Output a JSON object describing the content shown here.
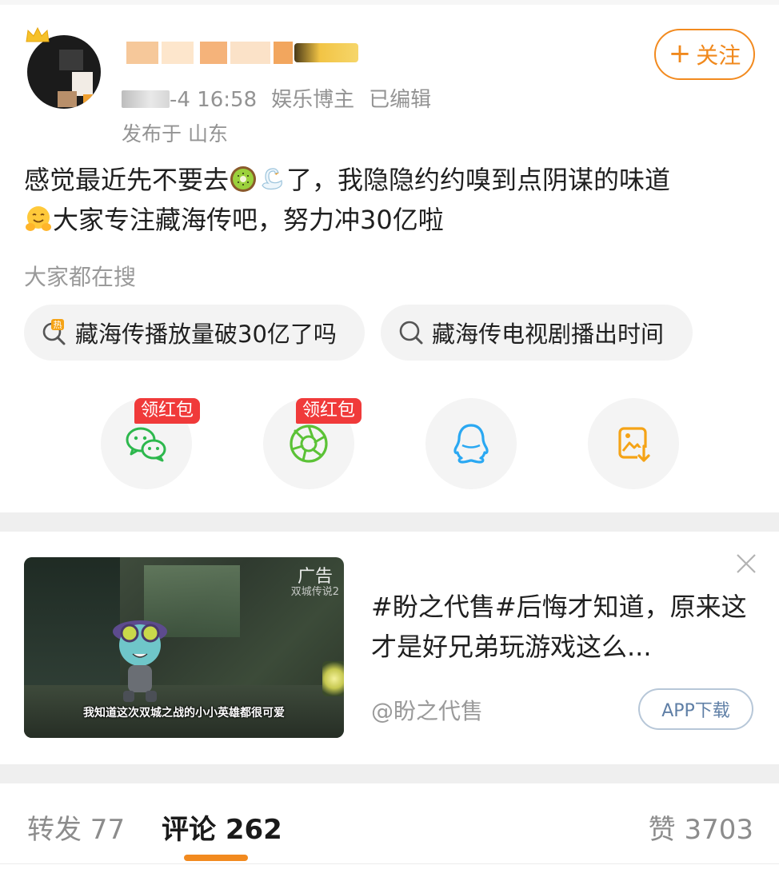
{
  "post": {
    "meta_date": "-4 16:58",
    "meta_role": "娱乐博主",
    "meta_edited": "已编辑",
    "location": "发布于 山东",
    "follow_label": "关注",
    "body_line1_a": "感觉最近先不要去",
    "body_line1_b": "了，我隐隐约约嗅到点阴谋的味道",
    "body_line2": "大家专注藏海传吧，努力冲30亿啦"
  },
  "search": {
    "heading": "大家都在搜",
    "chips": [
      {
        "label": "藏海传播放量破30亿了吗",
        "icon": "hot-search-icon"
      },
      {
        "label": "藏海传电视剧播出时间",
        "icon": "search-icon"
      }
    ]
  },
  "share": {
    "redpack_label": "领红包",
    "buttons": [
      {
        "icon": "wechat-icon",
        "color": "#2db84d"
      },
      {
        "icon": "wechat-moments-icon",
        "color": "#5bc236"
      },
      {
        "icon": "qq-icon",
        "color": "#2aa8f2"
      },
      {
        "icon": "save-image-icon",
        "color": "#f5a316"
      }
    ]
  },
  "ad": {
    "label": "广告",
    "game_name": "双城传说2",
    "thumb_subtitle": "我知道这次双城之战的小小英雄都很可爱",
    "title": "#盼之代售#后悔才知道，原来这才是好兄弟玩游戏这么...",
    "source": "@盼之代售",
    "cta": "APP下载"
  },
  "tabs": {
    "repost": "转发 77",
    "comment": "评论 262",
    "like": "赞 3703"
  },
  "colors": {
    "accent": "#f28a1f",
    "red_badge": "#f03a3a",
    "link_blue": "#5f7fa6"
  }
}
